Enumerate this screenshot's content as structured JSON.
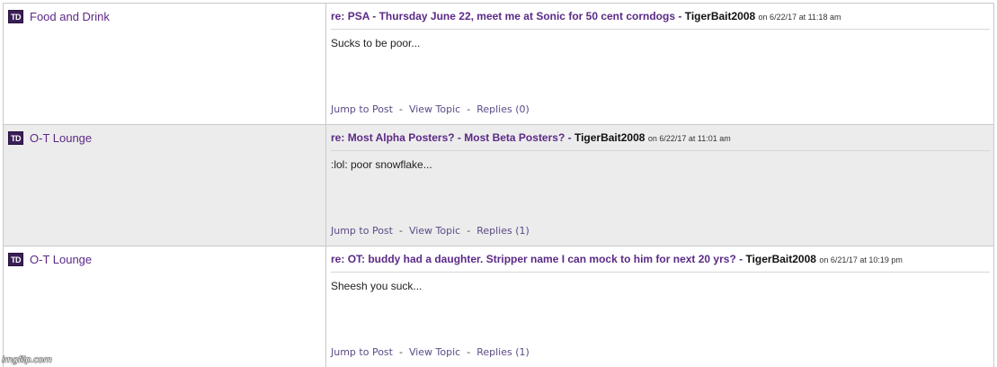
{
  "colors": {
    "accent": "#5b2a86",
    "alt_row": "#ececec",
    "logo_bg": "#3a1f57"
  },
  "watermark": "imgflip.com",
  "posts": [
    {
      "logo": "TD",
      "forum": "Food and Drink",
      "prefix": "re:",
      "title": "PSA - Thursday June 22, meet me at Sonic for 50 cent corndogs",
      "user": "TigerBait2008",
      "meta": "on 6/22/17 at 11:18 am",
      "body": "Sucks to be poor...",
      "jump": "Jump to Post",
      "view": "View Topic",
      "replies": "Replies (0)"
    },
    {
      "logo": "TD",
      "forum": "O-T Lounge",
      "prefix": "re:",
      "title": "Most Alpha Posters? - Most Beta Posters?",
      "user": "TigerBait2008",
      "meta": "on 6/22/17 at 11:01 am",
      "body": ":lol: poor snowflake...",
      "jump": "Jump to Post",
      "view": "View Topic",
      "replies": "Replies (1)"
    },
    {
      "logo": "TD",
      "forum": "O-T Lounge",
      "prefix": "re:",
      "title": "OT: buddy had a daughter. Stripper name I can mock to him for next 20 yrs?",
      "user": "TigerBait2008",
      "meta": "on 6/21/17 at 10:19 pm",
      "body": "Sheesh you suck...",
      "jump": "Jump to Post",
      "view": "View Topic",
      "replies": "Replies (1)"
    }
  ]
}
